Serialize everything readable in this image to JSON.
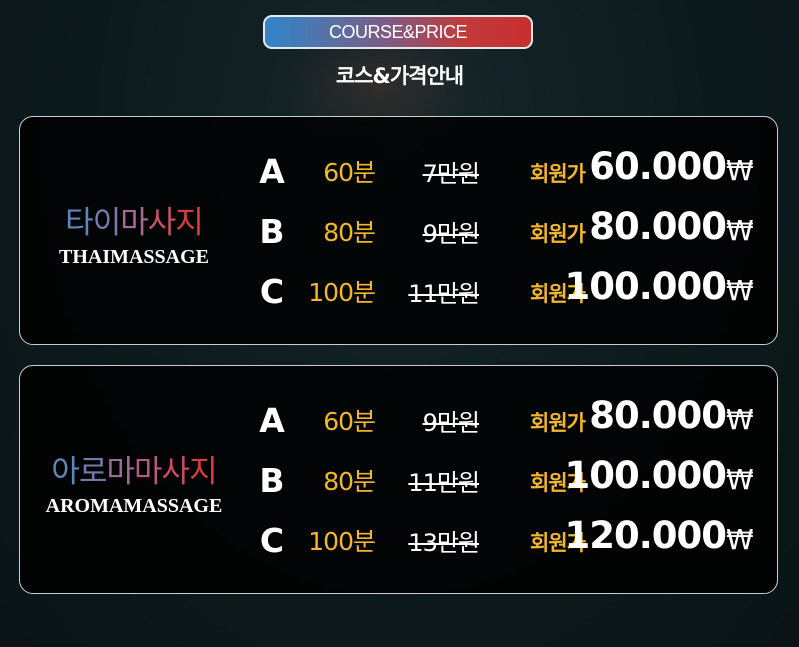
{
  "header": {
    "badge": "COURSE&PRICE",
    "subtitle": "코스&가격안내"
  },
  "currency_symbol": "₩",
  "member_label": "회원가",
  "colors": {
    "accent_yellow": "#f2b62b",
    "badge_blue": "#2f86c9",
    "badge_red": "#c62f2f",
    "brand_blue": "#5e86b8",
    "brand_red": "#d33f3f"
  },
  "sections": [
    {
      "name_ko": "타이마사지",
      "name_ko_parts": [
        "타",
        "이",
        "마",
        "사",
        "지"
      ],
      "name_en": "THAIMASSAGE",
      "courses": [
        {
          "letter": "A",
          "duration": "60분",
          "original_price": "7만원",
          "member_price": "60.000"
        },
        {
          "letter": "B",
          "duration": "80분",
          "original_price": "9만원",
          "member_price": "80.000"
        },
        {
          "letter": "C",
          "duration": "100분",
          "original_price": "11만원",
          "member_price": "100.000"
        }
      ]
    },
    {
      "name_ko": "아로마마사지",
      "name_ko_parts": [
        "아",
        "로",
        "마",
        "마",
        "사",
        "지"
      ],
      "name_en": "AROMAMASSAGE",
      "courses": [
        {
          "letter": "A",
          "duration": "60분",
          "original_price": "9만원",
          "member_price": "80.000"
        },
        {
          "letter": "B",
          "duration": "80분",
          "original_price": "11만원",
          "member_price": "100.000"
        },
        {
          "letter": "C",
          "duration": "100분",
          "original_price": "13만원",
          "member_price": "120.000"
        }
      ]
    }
  ]
}
